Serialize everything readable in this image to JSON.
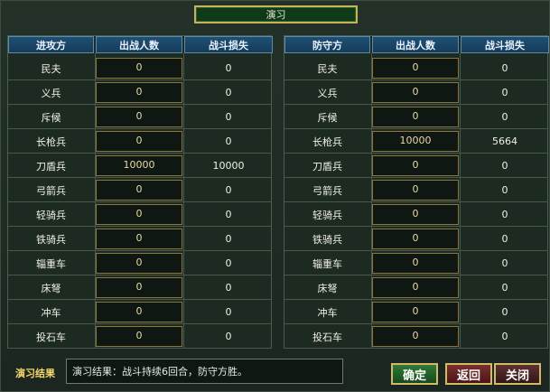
{
  "title": "演习",
  "attacker": {
    "headers": [
      "进攻方",
      "出战人数",
      "战斗损失"
    ],
    "rows": [
      {
        "name": "民夫",
        "count": "0",
        "loss": "0"
      },
      {
        "name": "义兵",
        "count": "0",
        "loss": "0"
      },
      {
        "name": "斥候",
        "count": "0",
        "loss": "0"
      },
      {
        "name": "长枪兵",
        "count": "0",
        "loss": "0"
      },
      {
        "name": "刀盾兵",
        "count": "10000",
        "loss": "10000"
      },
      {
        "name": "弓箭兵",
        "count": "0",
        "loss": "0"
      },
      {
        "name": "轻骑兵",
        "count": "0",
        "loss": "0"
      },
      {
        "name": "铁骑兵",
        "count": "0",
        "loss": "0"
      },
      {
        "name": "辎重车",
        "count": "0",
        "loss": "0"
      },
      {
        "name": "床弩",
        "count": "0",
        "loss": "0"
      },
      {
        "name": "冲车",
        "count": "0",
        "loss": "0"
      },
      {
        "name": "投石车",
        "count": "0",
        "loss": "0"
      }
    ]
  },
  "defender": {
    "headers": [
      "防守方",
      "出战人数",
      "战斗损失"
    ],
    "rows": [
      {
        "name": "民夫",
        "count": "0",
        "loss": "0"
      },
      {
        "name": "义兵",
        "count": "0",
        "loss": "0"
      },
      {
        "name": "斥候",
        "count": "0",
        "loss": "0"
      },
      {
        "name": "长枪兵",
        "count": "10000",
        "loss": "5664"
      },
      {
        "name": "刀盾兵",
        "count": "0",
        "loss": "0"
      },
      {
        "name": "弓箭兵",
        "count": "0",
        "loss": "0"
      },
      {
        "name": "轻骑兵",
        "count": "0",
        "loss": "0"
      },
      {
        "name": "铁骑兵",
        "count": "0",
        "loss": "0"
      },
      {
        "name": "辎重车",
        "count": "0",
        "loss": "0"
      },
      {
        "name": "床弩",
        "count": "0",
        "loss": "0"
      },
      {
        "name": "冲车",
        "count": "0",
        "loss": "0"
      },
      {
        "name": "投石车",
        "count": "0",
        "loss": "0"
      }
    ]
  },
  "result": {
    "label": "演习结果",
    "text": "演习结果：战斗持续6回合，防守方胜。"
  },
  "buttons": {
    "confirm": "确定",
    "back": "返回",
    "close": "关闭"
  }
}
